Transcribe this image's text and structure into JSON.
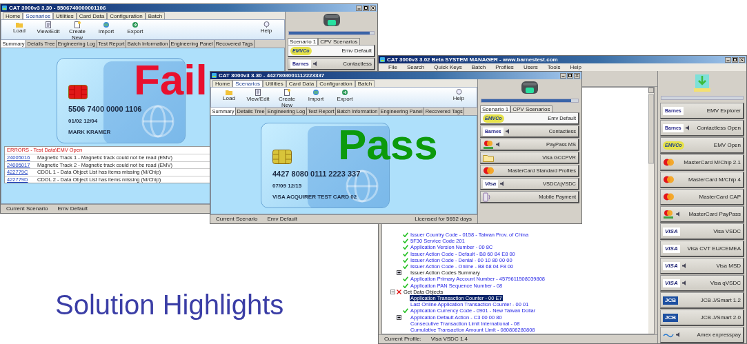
{
  "slide_title": "Solution Highlights",
  "windows": [
    {
      "kind": "scenario",
      "title": "CAT 3000v3  3.30 - 5506740000001106",
      "ribbon_tabs": [
        {
          "label": "Home",
          "selected": false
        },
        {
          "label": "Scenarios",
          "selected": true
        },
        {
          "label": "Utilities",
          "selected": false
        },
        {
          "label": "Card Data",
          "selected": false
        },
        {
          "label": "Configuration",
          "selected": false
        },
        {
          "label": "Batch",
          "selected": false
        }
      ],
      "toolbar": [
        "Load",
        "View/Edit",
        "Create New",
        "Import",
        "Export"
      ],
      "help": "Help",
      "view_tabs": [
        {
          "label": "Summary",
          "selected": true
        },
        {
          "label": "Details Tree",
          "selected": false
        },
        {
          "label": "Engineering Log",
          "selected": false
        },
        {
          "label": "Test Report",
          "selected": false
        },
        {
          "label": "Batch Information",
          "selected": false
        },
        {
          "label": "Engineering Panel",
          "selected": false
        },
        {
          "label": "Recovered Tags",
          "selected": false
        }
      ],
      "result": {
        "passed": false,
        "label": "Fail"
      },
      "card": {
        "number": "5506 7400 0000 1106",
        "dates": "01/02 12/04",
        "holder": "MARK KRAMER"
      },
      "errors": {
        "title": "ERRORS - Test Data\\EMV Open",
        "rows": [
          {
            "code": "24005016",
            "message": "Magnetic Track 1 - Magnetic track could not be read (EMV)"
          },
          {
            "code": "24005017",
            "message": "Magnetic Track 2 - Magnetic track could not be read (EMV)"
          },
          {
            "code": "422779C",
            "message": "CDOL 1 - Data Object List has items missing (M/Chip)"
          },
          {
            "code": "422779D",
            "message": "CDOL 2 - Data Object List has items missing (M/Chip)"
          }
        ]
      },
      "status_bar": {
        "label": "Current Scenario",
        "value": "Emv Default"
      },
      "panel": {
        "level": 0.95,
        "tabs": [
          {
            "label": "Scenario 1",
            "selected": true
          },
          {
            "label": "CPV Scenarios",
            "selected": false
          }
        ],
        "scenarios": [
          {
            "label": "Emv Default",
            "kind": "emvco",
            "logo_text": "EMVCo",
            "speaker": false,
            "selected": true
          },
          {
            "label": "Contactless",
            "kind": "barnes",
            "logo_text": "Barnes",
            "speaker": true,
            "selected": false
          }
        ]
      }
    },
    {
      "kind": "scenario",
      "title": "CAT 3000v3  3.30 - 4427808001112223337",
      "ribbon_tabs": [
        {
          "label": "Home",
          "selected": false
        },
        {
          "label": "Scenarios",
          "selected": true
        },
        {
          "label": "Utilities",
          "selected": false
        },
        {
          "label": "Card Data",
          "selected": false
        },
        {
          "label": "Configuration",
          "selected": false
        },
        {
          "label": "Batch",
          "selected": false
        }
      ],
      "toolbar": [
        "Load",
        "View/Edit",
        "Create New",
        "Import",
        "Export"
      ],
      "help": "Help",
      "view_tabs": [
        {
          "label": "Summary",
          "selected": true
        },
        {
          "label": "Details Tree",
          "selected": false
        },
        {
          "label": "Engineering Log",
          "selected": false
        },
        {
          "label": "Test Report",
          "selected": false
        },
        {
          "label": "Batch Information",
          "selected": false
        },
        {
          "label": "Engineering Panel",
          "selected": false
        },
        {
          "label": "Recovered Tags",
          "selected": false
        }
      ],
      "result": {
        "passed": true,
        "label": "Pass"
      },
      "card": {
        "number": "4427 8080 0111 2223 337",
        "dates": "07/09 12/15",
        "holder": "VISA ACQUIRER TEST CARD 02"
      },
      "status_bar": {
        "label": "Current Scenario",
        "value": "Emv Default",
        "license": "Licensed for 5652 days"
      },
      "panel": {
        "level": 0.93,
        "tabs": [
          {
            "label": "Scenario 1",
            "selected": true
          },
          {
            "label": "CPV Scenarios",
            "selected": false
          }
        ],
        "scenarios": [
          {
            "label": "Emv Default",
            "kind": "emvco",
            "logo_text": "EMVCo",
            "speaker": false,
            "selected": true
          },
          {
            "label": "Contactless",
            "kind": "barnes",
            "logo_text": "Barnes",
            "speaker": true,
            "selected": false
          },
          {
            "label": "PayPass MS",
            "kind": "paypass",
            "speaker": true,
            "selected": false
          },
          {
            "label": "Visa GCCPVR",
            "kind": "folder",
            "speaker": false,
            "selected": false
          },
          {
            "label": "MasterCard Standard Profiles",
            "kind": "mastercard",
            "speaker": false,
            "selected": false
          },
          {
            "label": "VSDC/qVSDC",
            "kind": "visa",
            "logo_text": "Visa",
            "speaker": true,
            "selected": false
          },
          {
            "label": "Mobile Payment",
            "kind": "mobile",
            "speaker": false,
            "selected": false
          }
        ]
      }
    },
    {
      "kind": "manager",
      "title": "CAT 3000v3  3.02 Beta  SYSTEM MANAGER   - www.barnestest.com",
      "menu": [
        "File",
        "Search",
        "Quick Keys",
        "Batch",
        "Profiles",
        "Users",
        "Tools",
        "Help"
      ],
      "tree": {
        "items": [
          {
            "kind": "continuation",
            "children": [
              {
                "kind": "value",
                "label": "Issuer Country Code - 0158 - Taiwan Prov. of China",
                "passed": true,
                "selected": false
              },
              {
                "kind": "value",
                "label": "5F30 Service Code 201",
                "passed": true,
                "selected": false
              },
              {
                "kind": "value",
                "label": "Application Version Number - 00 8C",
                "passed": true,
                "selected": false
              },
              {
                "kind": "value",
                "label": "Issuer Action Code - Default - B8 60 84 E8 00",
                "passed": true,
                "selected": false
              },
              {
                "kind": "value",
                "label": "Issuer Action Code - Denial - 00 10 80 00 00",
                "passed": true,
                "selected": false
              },
              {
                "kind": "value",
                "label": "Issuer Action Code - Online - B8 68 04 F8 00",
                "passed": true,
                "selected": false
              },
              {
                "kind": "group",
                "label": "Issuer Action Codes Summary",
                "expanded": false,
                "selected": false
              },
              {
                "kind": "value",
                "label": "Application Primary Account Number - 4579611508039808",
                "passed": true,
                "selected": false
              },
              {
                "kind": "value",
                "label": "Application PAN Sequence Number - 08",
                "passed": true,
                "selected": false
              }
            ]
          },
          {
            "kind": "group",
            "label": "Get Data Objects",
            "passed": false,
            "expanded": true,
            "selected": false,
            "children": [
              {
                "kind": "value",
                "label": "Application Transaction Counter - 00 E7",
                "selected": true
              },
              {
                "kind": "value",
                "label": "Last Online Application Transaction Counter - 00 01",
                "selected": false
              },
              {
                "kind": "value",
                "label": "Application Currency Code - 0901 - New Taiwan Dollar",
                "passed": true,
                "selected": false
              },
              {
                "kind": "value",
                "label": "Application Default Action - C3 00 00 80",
                "expanded": false,
                "selected": false
              },
              {
                "kind": "value",
                "label": "Consecutive Transaction Limit International - 08",
                "selected": false
              },
              {
                "kind": "value",
                "label": "Cumulative Transaction Amount Limit - 080808280808",
                "selected": false
              }
            ]
          }
        ]
      },
      "status_bar": {
        "label": "Current Profile:",
        "value": "Visa VSDC 1.4"
      },
      "panel": {
        "profiles": [
          {
            "label": "EMV Explorer",
            "kind": "barnes",
            "logo_text": "Barnes",
            "speaker": false
          },
          {
            "label": "Contactless Open",
            "kind": "barnes",
            "logo_text": "Barnes",
            "speaker": true
          },
          {
            "label": "EMV Open",
            "kind": "emvco",
            "logo_text": "EMVCo",
            "speaker": false
          },
          {
            "label": "MasterCard M/Chip 2.1",
            "kind": "mastercard",
            "speaker": false
          },
          {
            "label": "MasterCard M/Chip 4",
            "kind": "mastercard",
            "speaker": false
          },
          {
            "label": "MasterCard CAP",
            "kind": "mastercard",
            "speaker": false
          },
          {
            "label": "MasterCard PayPass",
            "kind": "paypass",
            "speaker": true
          },
          {
            "label": "Visa VSDC",
            "kind": "visa",
            "logo_text": "VISA",
            "speaker": false
          },
          {
            "label": "Visa CVT EU/CEMEA",
            "kind": "visa",
            "logo_text": "VISA",
            "speaker": false
          },
          {
            "label": "Visa MSD",
            "kind": "visa",
            "logo_text": "VISA",
            "speaker": true
          },
          {
            "label": "Visa qVSDC",
            "kind": "visa",
            "logo_text": "VISA",
            "speaker": true
          },
          {
            "label": "JCB J/Smart 1.2",
            "kind": "jcb",
            "logo_text": "JCB",
            "speaker": false
          },
          {
            "label": "JCB J/Smart 2.0",
            "kind": "jcb",
            "logo_text": "JCB",
            "speaker": false
          },
          {
            "label": "Amex expresspay",
            "kind": "expresspay",
            "speaker": true
          }
        ]
      }
    }
  ]
}
